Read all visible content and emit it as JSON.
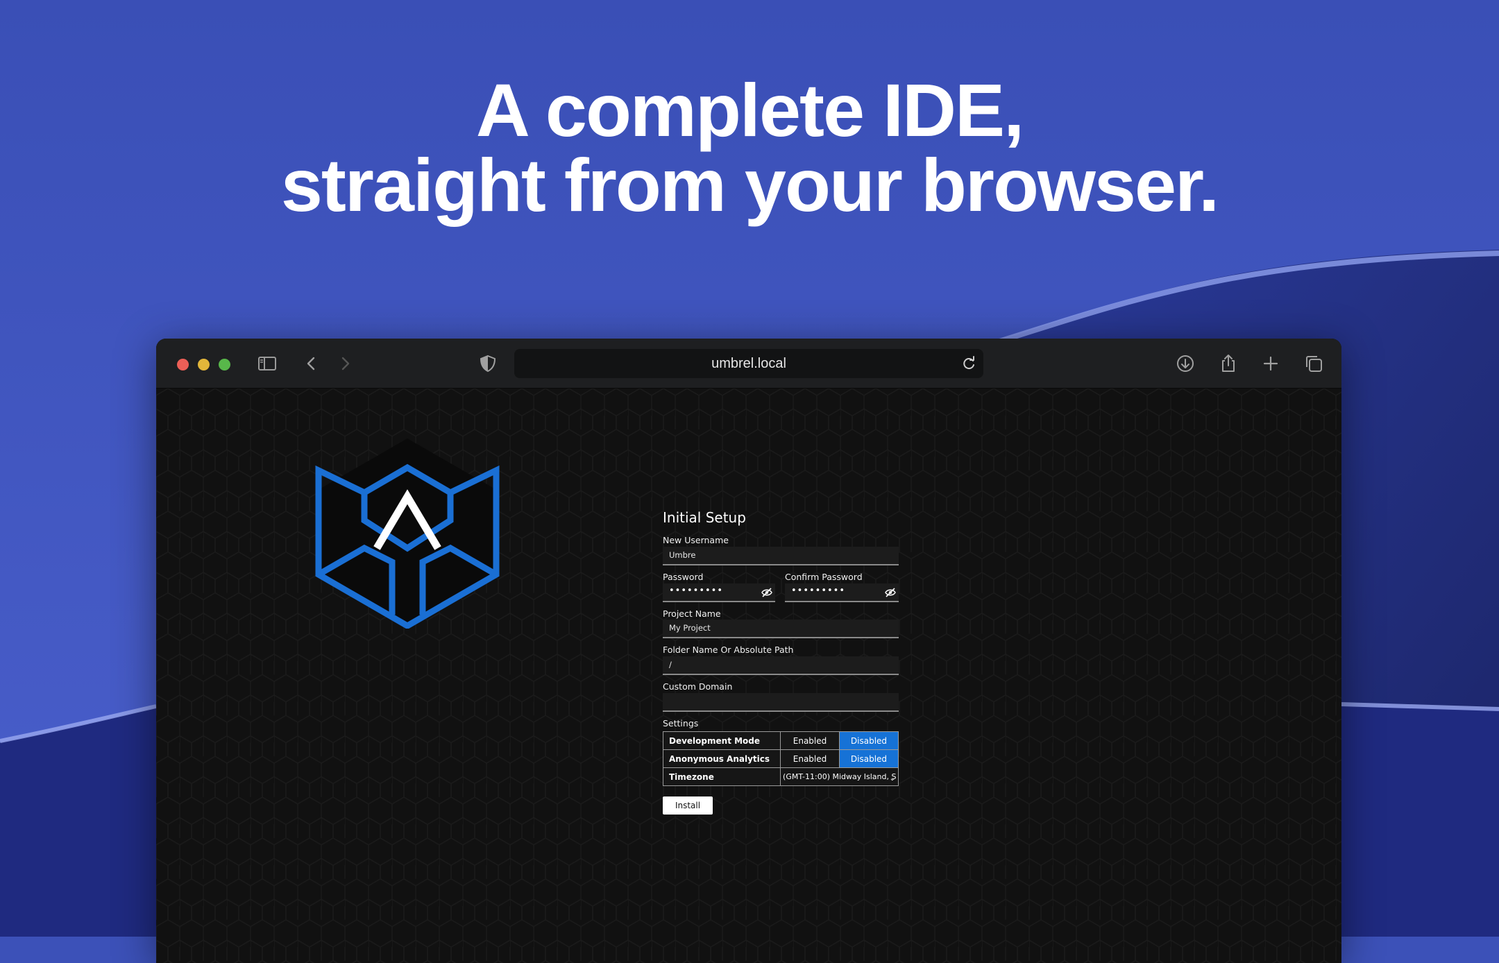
{
  "headline": {
    "line1": "A complete IDE,",
    "line2": "straight from your browser."
  },
  "browser": {
    "url": "umbrel.local",
    "icons": [
      "sidebar-icon",
      "back-icon",
      "forward-icon",
      "shield-icon",
      "reload-icon",
      "download-icon",
      "share-icon",
      "new-tab-icon",
      "tabs-overview-icon"
    ]
  },
  "setup": {
    "title": "Initial Setup",
    "username_label": "New Username",
    "username_value": "Umbre",
    "password_label": "Password",
    "password_value": "•••••••••",
    "confirm_label": "Confirm Password",
    "confirm_value": "•••••••••",
    "project_label": "Project Name",
    "project_value": "My Project",
    "folder_label": "Folder Name Or Absolute Path",
    "folder_value": "/",
    "domain_label": "Custom Domain",
    "domain_value": "",
    "settings_label": "Settings",
    "settings": [
      {
        "label": "Development Mode",
        "enabled": "Enabled",
        "disabled": "Disabled",
        "selected": "Disabled"
      },
      {
        "label": "Anonymous Analytics",
        "enabled": "Enabled",
        "disabled": "Disabled",
        "selected": "Disabled"
      }
    ],
    "timezone_label": "Timezone",
    "timezone_value": "(GMT-11:00) Midway Island, S",
    "install_label": "Install"
  },
  "colors": {
    "background": "#3c51b8",
    "accent": "#1672d6",
    "logo": "#1a6fd4"
  }
}
